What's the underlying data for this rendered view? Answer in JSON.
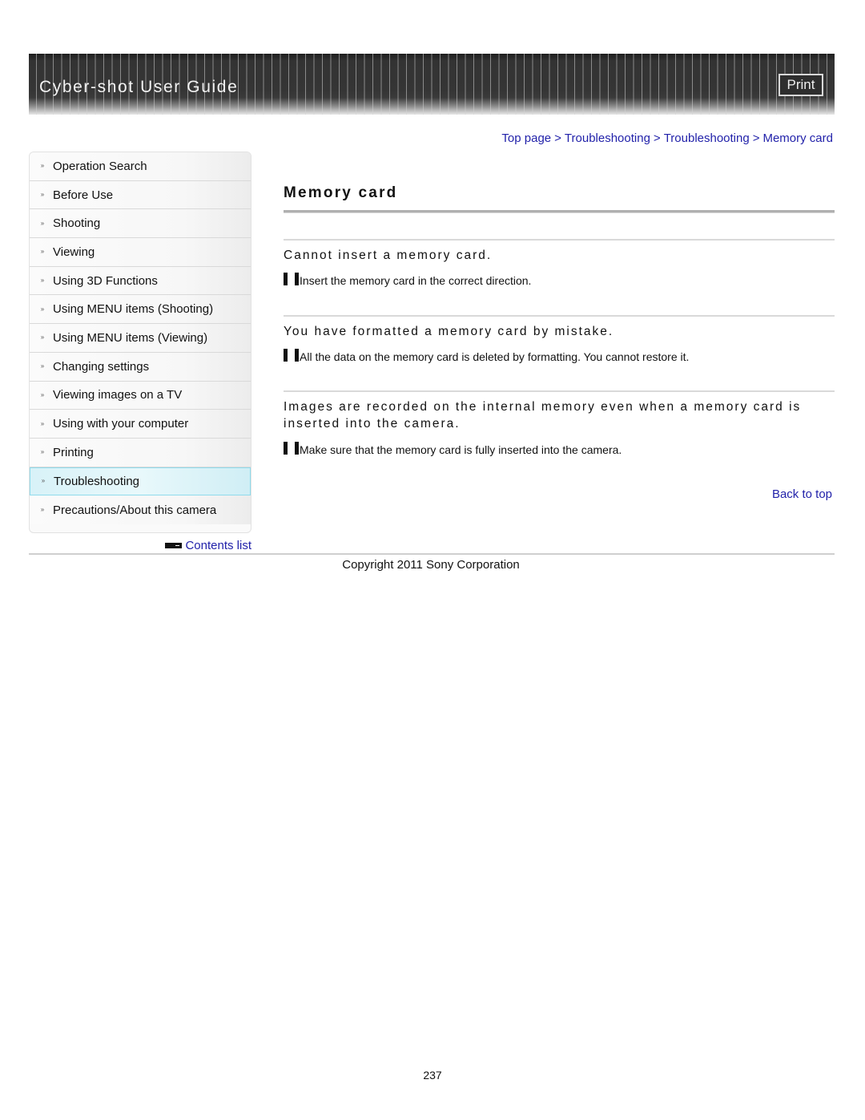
{
  "header": {
    "title": "Cyber-shot User Guide",
    "print_label": "Print"
  },
  "breadcrumb": {
    "items": [
      "Top page",
      "Troubleshooting",
      "Troubleshooting",
      "Memory card"
    ],
    "separator": ">"
  },
  "sidebar": {
    "bullet_icon": "double-chevron-icon",
    "items": [
      {
        "label": "Operation Search",
        "active": false
      },
      {
        "label": "Before Use",
        "active": false
      },
      {
        "label": "Shooting",
        "active": false
      },
      {
        "label": "Viewing",
        "active": false
      },
      {
        "label": "Using 3D Functions",
        "active": false
      },
      {
        "label": "Using MENU items (Shooting)",
        "active": false
      },
      {
        "label": "Using MENU items (Viewing)",
        "active": false
      },
      {
        "label": "Changing settings",
        "active": false
      },
      {
        "label": "Viewing images on a TV",
        "active": false
      },
      {
        "label": "Using with your computer",
        "active": false
      },
      {
        "label": "Printing",
        "active": false
      },
      {
        "label": "Troubleshooting",
        "active": true
      },
      {
        "label": "Precautions/About this camera",
        "active": false
      }
    ],
    "contents_list_label": "Contents list"
  },
  "main": {
    "title": "Memory card",
    "sections": [
      {
        "question": "Cannot insert a memory card.",
        "answer": "Insert the memory card in the correct direction."
      },
      {
        "question": "You have formatted a memory card by mistake.",
        "answer": "All the data on the memory card is deleted by formatting. You cannot restore it."
      },
      {
        "question": "Images are recorded on the internal memory even when a memory card is inserted into the camera.",
        "answer": "Make sure that the memory card is fully inserted into the camera."
      }
    ],
    "back_to_top_label": "Back to top"
  },
  "footer": {
    "copyright": "Copyright 2011 Sony Corporation",
    "page_number": "237"
  },
  "colors": {
    "link": "#2222aa",
    "active_item_bg": "#d8f2f8",
    "active_item_border": "#8fdbec",
    "header_bg": "#333333"
  }
}
